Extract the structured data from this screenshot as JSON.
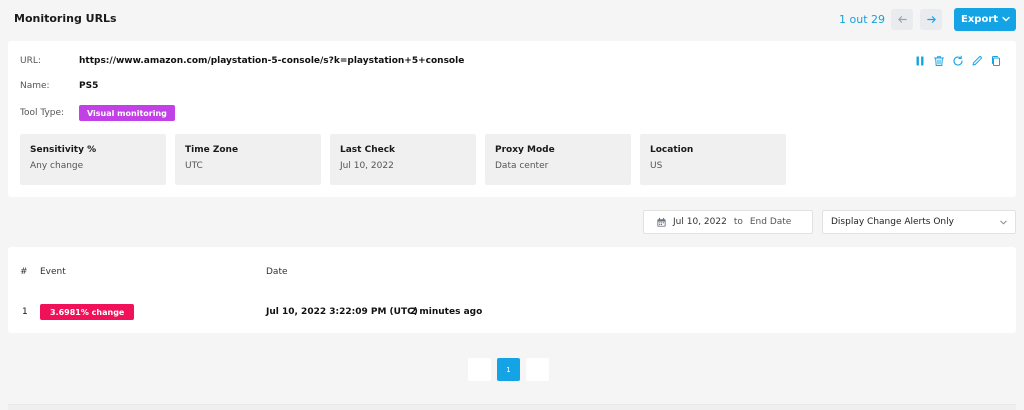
{
  "header": {
    "title": "Monitoring URLs",
    "counter": "1 out 29",
    "export_label": "Export"
  },
  "url_card": {
    "url_label": "URL:",
    "url_value": "https://www.amazon.com/playstation-5-console/s?k=playstation+5+console",
    "name_label": "Name:",
    "name_value": "PS5",
    "tool_type_label": "Tool Type:",
    "tool_type_value": "Visual monitoring",
    "info": [
      {
        "title": "Sensitivity %",
        "value": "Any change"
      },
      {
        "title": "Time Zone",
        "value": "UTC"
      },
      {
        "title": "Last Check",
        "value": "Jul 10, 2022"
      },
      {
        "title": "Proxy Mode",
        "value": "Data center"
      },
      {
        "title": "Location",
        "value": "US"
      }
    ]
  },
  "filters": {
    "start_date": "Jul 10, 2022",
    "to_label": "to",
    "end_date_placeholder": "End Date",
    "alert_filter": "Display Change Alerts Only"
  },
  "events_table": {
    "columns": [
      "#",
      "Event",
      "Date"
    ],
    "rows": [
      {
        "index": "1",
        "event": "3.6981% change",
        "date": "Jul 10, 2022 3:22:09 PM (UTC)",
        "relative": "2 minutes ago"
      }
    ]
  },
  "pagination": {
    "current_page": "1"
  },
  "colors": {
    "accent": "#14a3e5",
    "badge_purple": "#c241e6",
    "badge_red": "#f0115a"
  }
}
